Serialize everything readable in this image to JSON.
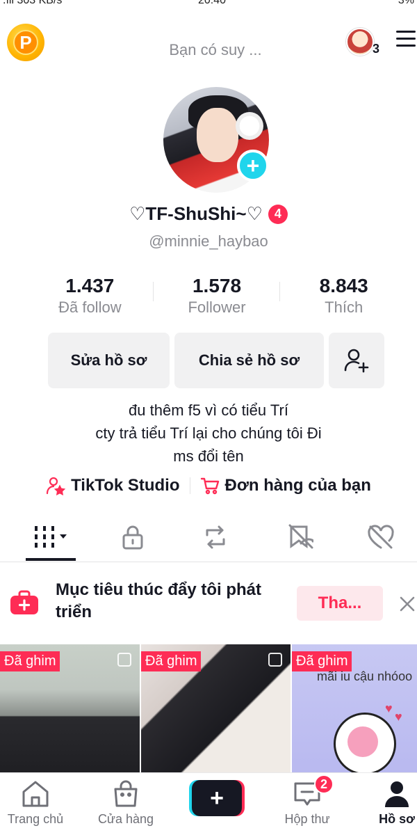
{
  "status_bar": {
    "left": ".ıll 303 KB/s",
    "time": "20:40",
    "right": "3%"
  },
  "header": {
    "coin_icon_label": "P",
    "suggest_label": "Bạn có suy ...",
    "friends_count": "3"
  },
  "profile": {
    "display_name": "♡TF-ShuShi~♡",
    "name_badge": "4",
    "username": "@minnie_haybao"
  },
  "stats": [
    {
      "value": "1.437",
      "label": "Đã follow"
    },
    {
      "value": "1.578",
      "label": "Follower"
    },
    {
      "value": "8.843",
      "label": "Thích"
    }
  ],
  "actions": {
    "edit_label": "Sửa hồ sơ",
    "share_label": "Chia sẻ hồ sơ"
  },
  "bio": {
    "line1": "đu thêm f5 vì có tiểu Trí",
    "line2": "cty trả tiểu Trí lại cho chúng tôi Đi",
    "line3": "ms đổi tên"
  },
  "links": {
    "studio": "TikTok Studio",
    "orders": "Đơn hàng của bạn"
  },
  "goal_banner": {
    "text": "Mục tiêu thúc đẩy tôi phát triển",
    "button_label": "Tha..."
  },
  "videos": [
    {
      "pinned_label": "Đã ghim"
    },
    {
      "pinned_label": "Đã ghim"
    },
    {
      "pinned_label": "Đã ghim",
      "caption": "mãi iu cậu nhóoo"
    }
  ],
  "bottom_nav": {
    "home": "Trang chủ",
    "shop": "Cửa hàng",
    "inbox": "Hộp thư",
    "inbox_badge": "2",
    "profile": "Hồ sơ"
  },
  "colors": {
    "accent": "#fe2c55",
    "cyan": "#20d5ec",
    "text": "#161823",
    "muted": "#8a8b91"
  }
}
